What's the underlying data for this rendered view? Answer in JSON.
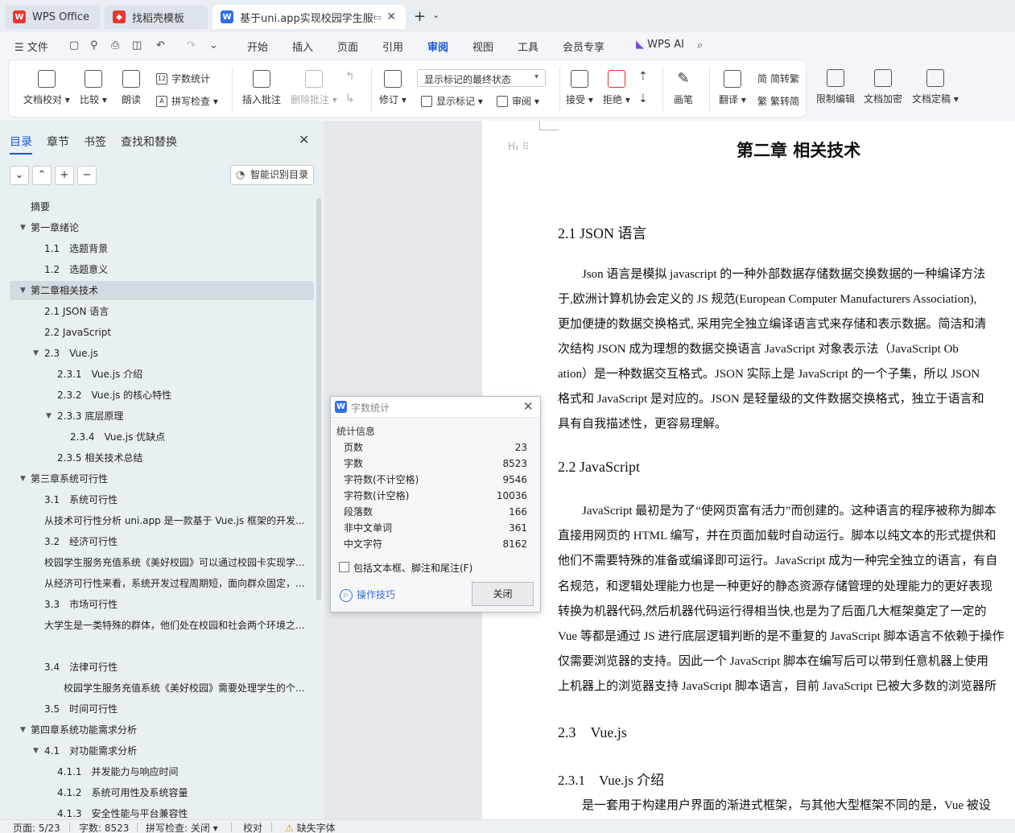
{
  "tabs": [
    {
      "label": "WPS Office"
    },
    {
      "label": "找稻壳模板"
    },
    {
      "label": "基于uni.app实现校园学生服务"
    }
  ],
  "menubar": {
    "file": "文件",
    "items": [
      "开始",
      "插入",
      "页面",
      "引用",
      "审阅",
      "视图",
      "工具",
      "会员专享"
    ],
    "active": "审阅",
    "wps_ai": "WPS AI"
  },
  "ribbon": {
    "doc_check": "文档校对",
    "compare": "比较",
    "read_aloud": "朗读",
    "word_count": "字数统计",
    "spell_check": "拼写检查",
    "insert_comment": "插入批注",
    "delete_comment": "删除批注",
    "revise": "修订",
    "markup_state": "显示标记的最终状态",
    "show_markup": "显示标记",
    "review": "审阅",
    "accept": "接受",
    "reject": "拒绝",
    "ink": "画笔",
    "translate": "翻译",
    "to_traditional": "简转繁",
    "to_simplified": "繁转简",
    "restrict_edit": "限制编辑",
    "encrypt": "文档加密",
    "finalize": "文档定稿"
  },
  "nav": {
    "tabs": [
      "目录",
      "章节",
      "书签",
      "查找和替换"
    ],
    "smart_toc": "智能识别目录",
    "toc": [
      {
        "text": "摘要",
        "level": 0,
        "arrow": ""
      },
      {
        "text": "第一章绪论",
        "level": 0,
        "arrow": "down"
      },
      {
        "text": "1.1　选题背景",
        "level": 1,
        "arrow": ""
      },
      {
        "text": "1.2　选题意义",
        "level": 1,
        "arrow": ""
      },
      {
        "text": "第二章相关技术",
        "level": 0,
        "arrow": "down",
        "active": true
      },
      {
        "text": "2.1 JSON 语言",
        "level": 1,
        "arrow": ""
      },
      {
        "text": "2.2 JavaScript",
        "level": 1,
        "arrow": ""
      },
      {
        "text": "2.3　Vue.js",
        "level": 1,
        "arrow": "down"
      },
      {
        "text": "2.3.1　Vue.js 介绍",
        "level": 2,
        "arrow": ""
      },
      {
        "text": "2.3.2　Vue.js 的核心特性",
        "level": 2,
        "arrow": ""
      },
      {
        "text": "2.3.3 底层原理",
        "level": 2,
        "arrow": "down"
      },
      {
        "text": "2.3.4　Vue.js 优缺点",
        "level": 3,
        "arrow": ""
      },
      {
        "text": "2.3.5 相关技术总结",
        "level": 2,
        "arrow": ""
      },
      {
        "text": "第三章系统可行性",
        "level": 0,
        "arrow": "down"
      },
      {
        "text": "3.1　系统可行性",
        "level": 1,
        "arrow": ""
      },
      {
        "text": "从技术可行性分析 uni.app 是一款基于 Vue.js 框架的开发...",
        "level": 1,
        "arrow": ""
      },
      {
        "text": "3.2　经济可行性",
        "level": 1,
        "arrow": ""
      },
      {
        "text": "校园学生服务充值系统《美好校园》可以通过校园卡实现学...",
        "level": 1,
        "arrow": ""
      },
      {
        "text": "从经济可行性来看，系统开发过程周期短，面向群众固定，...",
        "level": 1,
        "arrow": ""
      },
      {
        "text": "3.3　市场可行性",
        "level": 1,
        "arrow": ""
      },
      {
        "text": "大学生是一类特殊的群体，他们处在校园和社会两个环境之...",
        "level": 1,
        "arrow": ""
      },
      {
        "text": "",
        "level": 1,
        "arrow": ""
      },
      {
        "text": "3.4　法律可行性",
        "level": 1,
        "arrow": ""
      },
      {
        "text": "校园学生服务充值系统《美好校园》需要处理学生的个...",
        "level": 2.5,
        "arrow": ""
      },
      {
        "text": "3.5　时间可行性",
        "level": 1,
        "arrow": ""
      },
      {
        "text": "第四章系统功能需求分析",
        "level": 0,
        "arrow": "down"
      },
      {
        "text": "4.1　对功能需求分析",
        "level": 1,
        "arrow": "down"
      },
      {
        "text": "4.1.1　并发能力与响应时间",
        "level": 2,
        "arrow": ""
      },
      {
        "text": "4.1.2　系统可用性及系统容量",
        "level": 2,
        "arrow": ""
      },
      {
        "text": "4.1.3　安全性能与平台兼容性",
        "level": 2,
        "arrow": ""
      }
    ]
  },
  "document": {
    "chapter_title": "第二章  相关技术",
    "h_21": "2.1 JSON 语言",
    "p_21": [
      "　　Json 语言是模拟 javascript 的一种外部数据存储数据交换数据的一种编译方法",
      "于,欧洲计算机协会定义的 JS 规范(European  Computer  Manufacturers  Association),",
      "更加便捷的数据交换格式, 采用完全独立编译语言式来存储和表示数据。简洁和清",
      "次结构 JSON 成为理想的数据交换语言 JavaScript 对象表示法（JavaScript         Ob",
      "ation）是一种数据交互格式。JSON 实际上是  JavaScript  的一个子集，所以 JSON",
      "格式和  JavaScript  是对应的。JSON 是轻量级的文件数据交换格式，独立于语言和",
      "具有自我描述性，更容易理解。"
    ],
    "h_22": "2.2 JavaScript",
    "p_22": [
      "　　JavaScript 最初是为了“使网页富有活力”而创建的。这种语言的程序被称为脚本",
      "直接用网页的 HTML 编写，并在页面加载时自动运行。脚本以纯文本的形式提供和",
      "他们不需要特殊的准备或编译即可运行。JavaScript 成为一种完全独立的语言，有自",
      "名规范，和逻辑处理能力也是一种更好的静态资源存储管理的处理能力的更好表现",
      "转换为机器代码,然后机器代码运行得相当快,也是为了后面几大框架奠定了一定的",
      "Vue 等都是通过 JS 进行底层逻辑判断的是不重复的 JavaScript 脚本语言不依赖于操作",
      "仅需要浏览器的支持。因此一个 JavaScript 脚本在编写后可以带到任意机器上使用",
      "上机器上的浏览器支持 JavaScript 脚本语言，目前 JavaScript 已被大多数的浏览器所"
    ],
    "h_23": "2.3　Vue.js",
    "h_231": "2.3.1　Vue.js 介绍",
    "p_231": "　　是一套用于构建用户界面的渐进式框架，与其他大型框架不同的是，Vue 被设"
  },
  "word_count_dialog": {
    "title": "字数统计",
    "section": "统计信息",
    "rows": [
      {
        "label": "页数",
        "value": "23"
      },
      {
        "label": "字数",
        "value": "8523"
      },
      {
        "label": "字符数(不计空格)",
        "value": "9546"
      },
      {
        "label": "字符数(计空格)",
        "value": "10036"
      },
      {
        "label": "段落数",
        "value": "166"
      },
      {
        "label": "非中文单词",
        "value": "361"
      },
      {
        "label": "中文字符",
        "value": "8162"
      }
    ],
    "include_label": "包括文本框、脚注和尾注(F)",
    "tips": "操作技巧",
    "close": "关闭"
  },
  "status": {
    "page": "页面: 5/23",
    "words": "字数: 8523",
    "spell": "拼写检查: 关闭",
    "proof": "校对",
    "missing_font": "缺失字体"
  },
  "colors": {
    "accent": "#1a56db",
    "nav_bg": "#e9f0f4",
    "wps_red": "#e8362e",
    "word_blue": "#2f6fe4"
  }
}
